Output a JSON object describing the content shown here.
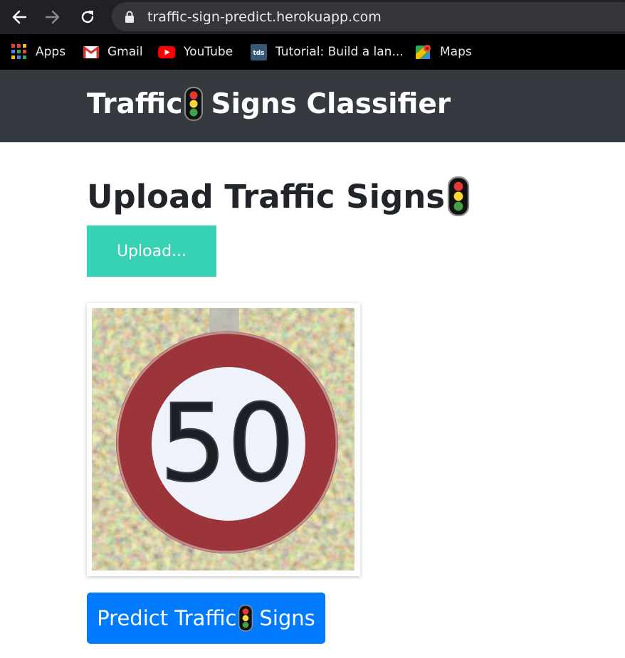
{
  "browser": {
    "url": "traffic-sign-predict.herokuapp.com",
    "bookmarks": [
      {
        "label": "Apps",
        "icon": "apps-grid-icon"
      },
      {
        "label": "Gmail",
        "icon": "gmail-icon"
      },
      {
        "label": "YouTube",
        "icon": "youtube-icon"
      },
      {
        "label": "Tutorial: Build a lan...",
        "icon": "tds-icon"
      },
      {
        "label": "Maps",
        "icon": "maps-icon"
      }
    ]
  },
  "navbar": {
    "brand_left": "Traffic",
    "brand_right": "Signs Classifier",
    "background": "#343a40"
  },
  "main": {
    "heading": "Upload Traffic Signs",
    "upload_label": "Upload...",
    "upload_color": "#37d2b4",
    "image_sign_text": "50",
    "predict_left": "Predict Traffic",
    "predict_right": "Signs",
    "predict_color": "#007bff"
  }
}
